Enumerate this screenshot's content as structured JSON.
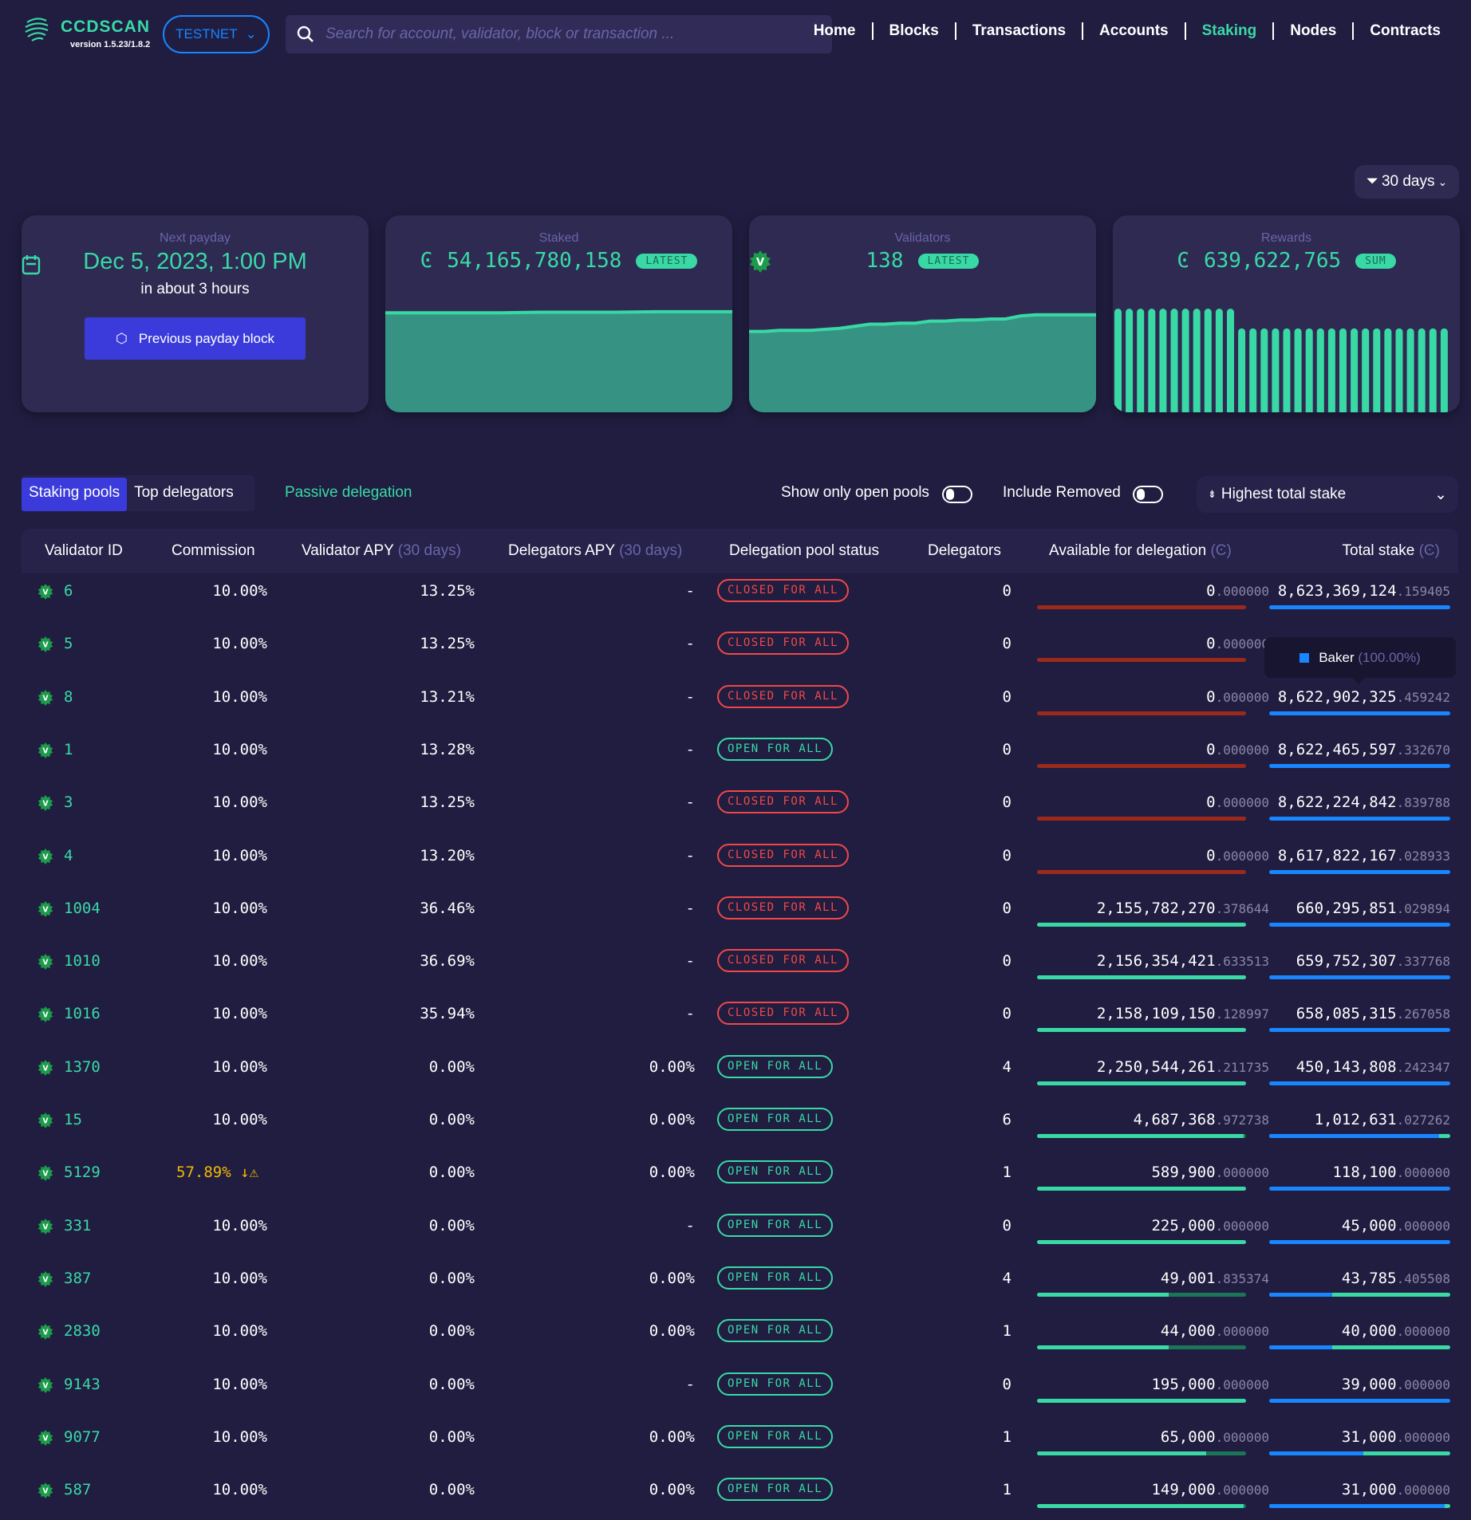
{
  "header": {
    "brand": "CCDSCAN",
    "version": "version 1.5.23/1.8.2",
    "network": "TESTNET",
    "search_placeholder": "Search for account, validator, block or transaction ...",
    "nav": [
      {
        "label": "Home",
        "active": false
      },
      {
        "label": "Blocks",
        "active": false
      },
      {
        "label": "Transactions",
        "active": false
      },
      {
        "label": "Accounts",
        "active": false
      },
      {
        "label": "Staking",
        "active": true
      },
      {
        "label": "Nodes",
        "active": false
      },
      {
        "label": "Contracts",
        "active": false
      }
    ]
  },
  "range_filter": "30 days",
  "cards": {
    "payday": {
      "label": "Next payday",
      "date": "Dec 5, 2023, 1:00 PM",
      "relative": "in about 3 hours",
      "button": "Previous payday block"
    },
    "staked": {
      "label": "Staked",
      "value": "54,165,780,158",
      "badge": "LATEST",
      "currency": "Ͼ"
    },
    "validators": {
      "label": "Validators",
      "value": "138",
      "badge": "LATEST"
    },
    "rewards": {
      "label": "Rewards",
      "value": "639,622,765",
      "badge": "SUM",
      "currency": "Ͼ"
    }
  },
  "chart_data": [
    {
      "type": "area",
      "series": [
        {
          "values": [
            0.96,
            0.96,
            0.96,
            0.96,
            0.965,
            0.965,
            0.965,
            0.97,
            0.97,
            0.97
          ]
        }
      ]
    },
    {
      "type": "area",
      "series": [
        {
          "values": [
            0.78,
            0.78,
            0.79,
            0.79,
            0.79,
            0.8,
            0.81,
            0.83,
            0.85,
            0.85,
            0.86,
            0.86,
            0.88,
            0.88,
            0.89,
            0.89,
            0.9,
            0.9,
            0.93,
            0.94,
            0.94,
            0.94,
            0.94,
            0.94
          ]
        }
      ]
    },
    {
      "type": "bar",
      "series": [
        {
          "values": [
            1,
            1,
            1,
            1,
            1,
            1,
            1,
            1,
            1,
            1,
            1,
            0.81,
            0.81,
            0.81,
            0.81,
            0.81,
            0.81,
            0.81,
            0.81,
            0.81,
            0.81,
            0.81,
            0.81,
            0.81,
            0.81,
            0.81,
            0.81,
            0.81,
            0.81,
            0.81
          ]
        }
      ]
    }
  ],
  "tabs": [
    {
      "label": "Staking pools",
      "active": true
    },
    {
      "label": "Top delegators",
      "active": false
    }
  ],
  "passive_delegation": "Passive delegation",
  "toggles": {
    "open_pools": "Show only open pools",
    "include_removed": "Include Removed"
  },
  "sort": "Highest total stake",
  "columns": {
    "validator_id": "Validator ID",
    "commission": "Commission",
    "validator_apy": "Validator APY",
    "validator_apy_note": "(30 days)",
    "delegators_apy": "Delegators APY",
    "delegators_apy_note": "(30 days)",
    "pool_status": "Delegation pool status",
    "delegators": "Delegators",
    "available": "Available for delegation",
    "available_note": "(Ͼ)",
    "total_stake": "Total stake",
    "total_stake_note": "(Ͼ)"
  },
  "tooltip": {
    "label": "Baker",
    "pct": "(100.00%)"
  },
  "colors": {
    "accent": "#39d9a6",
    "closed": "#f04848",
    "baker": "#1786ff",
    "warning": "#f5b800"
  },
  "rows": [
    {
      "id": "6",
      "commission": "10.00%",
      "vapy": "13.25%",
      "dapy": "-",
      "status": "CLOSED FOR ALL",
      "open": false,
      "delegators": "0",
      "avail_int": "0",
      "avail_dec": ".000000",
      "avail_fill": 0,
      "stake_int": "8,623,369,124",
      "stake_dec": ".159405",
      "baker_share": 1
    },
    {
      "id": "5",
      "commission": "10.00%",
      "vapy": "13.25%",
      "dapy": "-",
      "status": "CLOSED FOR ALL",
      "open": false,
      "delegators": "0",
      "avail_int": "0",
      "avail_dec": ".000000",
      "avail_fill": 0,
      "stake_int": "",
      "stake_dec": "",
      "baker_share": 1
    },
    {
      "id": "8",
      "commission": "10.00%",
      "vapy": "13.21%",
      "dapy": "-",
      "status": "CLOSED FOR ALL",
      "open": false,
      "delegators": "0",
      "avail_int": "0",
      "avail_dec": ".000000",
      "avail_fill": 0,
      "stake_int": "8,622,902,325",
      "stake_dec": ".459242",
      "baker_share": 1
    },
    {
      "id": "1",
      "commission": "10.00%",
      "vapy": "13.28%",
      "dapy": "-",
      "status": "OPEN FOR ALL",
      "open": true,
      "delegators": "0",
      "avail_int": "0",
      "avail_dec": ".000000",
      "avail_fill": 0,
      "stake_int": "8,622,465,597",
      "stake_dec": ".332670",
      "baker_share": 1
    },
    {
      "id": "3",
      "commission": "10.00%",
      "vapy": "13.25%",
      "dapy": "-",
      "status": "CLOSED FOR ALL",
      "open": false,
      "delegators": "0",
      "avail_int": "0",
      "avail_dec": ".000000",
      "avail_fill": 0,
      "stake_int": "8,622,224,842",
      "stake_dec": ".839788",
      "baker_share": 1
    },
    {
      "id": "4",
      "commission": "10.00%",
      "vapy": "13.20%",
      "dapy": "-",
      "status": "CLOSED FOR ALL",
      "open": false,
      "delegators": "0",
      "avail_int": "0",
      "avail_dec": ".000000",
      "avail_fill": 0,
      "stake_int": "8,617,822,167",
      "stake_dec": ".028933",
      "baker_share": 1
    },
    {
      "id": "1004",
      "commission": "10.00%",
      "vapy": "36.46%",
      "dapy": "-",
      "status": "CLOSED FOR ALL",
      "open": false,
      "delegators": "0",
      "avail_int": "2,155,782,270",
      "avail_dec": ".378644",
      "avail_fill": 1,
      "stake_int": "660,295,851",
      "stake_dec": ".029894",
      "baker_share": 1
    },
    {
      "id": "1010",
      "commission": "10.00%",
      "vapy": "36.69%",
      "dapy": "-",
      "status": "CLOSED FOR ALL",
      "open": false,
      "delegators": "0",
      "avail_int": "2,156,354,421",
      "avail_dec": ".633513",
      "avail_fill": 1,
      "stake_int": "659,752,307",
      "stake_dec": ".337768",
      "baker_share": 1
    },
    {
      "id": "1016",
      "commission": "10.00%",
      "vapy": "35.94%",
      "dapy": "-",
      "status": "CLOSED FOR ALL",
      "open": false,
      "delegators": "0",
      "avail_int": "2,158,109,150",
      "avail_dec": ".128997",
      "avail_fill": 1,
      "stake_int": "658,085,315",
      "stake_dec": ".267058",
      "baker_share": 1
    },
    {
      "id": "1370",
      "commission": "10.00%",
      "vapy": "0.00%",
      "dapy": "0.00%",
      "status": "OPEN FOR ALL",
      "open": true,
      "delegators": "4",
      "avail_int": "2,250,544,261",
      "avail_dec": ".211735",
      "avail_fill": 1,
      "stake_int": "450,143,808",
      "stake_dec": ".242347",
      "baker_share": 1
    },
    {
      "id": "15",
      "commission": "10.00%",
      "vapy": "0.00%",
      "dapy": "0.00%",
      "status": "OPEN FOR ALL",
      "open": true,
      "delegators": "6",
      "avail_int": "4,687,368",
      "avail_dec": ".972738",
      "avail_fill": 0.99,
      "stake_int": "1,012,631",
      "stake_dec": ".027262",
      "baker_share": 0.94
    },
    {
      "id": "5129",
      "commission": "57.89%",
      "commission_warning": true,
      "vapy": "0.00%",
      "dapy": "0.00%",
      "status": "OPEN FOR ALL",
      "open": true,
      "delegators": "1",
      "avail_int": "589,900",
      "avail_dec": ".000000",
      "avail_fill": 1,
      "stake_int": "118,100",
      "stake_dec": ".000000",
      "baker_share": 1
    },
    {
      "id": "331",
      "commission": "10.00%",
      "vapy": "0.00%",
      "dapy": "-",
      "status": "OPEN FOR ALL",
      "open": true,
      "delegators": "0",
      "avail_int": "225,000",
      "avail_dec": ".000000",
      "avail_fill": 1,
      "stake_int": "45,000",
      "stake_dec": ".000000",
      "baker_share": 1
    },
    {
      "id": "387",
      "commission": "10.00%",
      "vapy": "0.00%",
      "dapy": "0.00%",
      "status": "OPEN FOR ALL",
      "open": true,
      "delegators": "4",
      "avail_int": "49,001",
      "avail_dec": ".835374",
      "avail_fill": 0.63,
      "stake_int": "43,785",
      "stake_dec": ".405508",
      "baker_share": 0.35
    },
    {
      "id": "2830",
      "commission": "10.00%",
      "vapy": "0.00%",
      "dapy": "0.00%",
      "status": "OPEN FOR ALL",
      "open": true,
      "delegators": "1",
      "avail_int": "44,000",
      "avail_dec": ".000000",
      "avail_fill": 0.63,
      "stake_int": "40,000",
      "stake_dec": ".000000",
      "baker_share": 0.35
    },
    {
      "id": "9143",
      "commission": "10.00%",
      "vapy": "0.00%",
      "dapy": "-",
      "status": "OPEN FOR ALL",
      "open": true,
      "delegators": "0",
      "avail_int": "195,000",
      "avail_dec": ".000000",
      "avail_fill": 1,
      "stake_int": "39,000",
      "stake_dec": ".000000",
      "baker_share": 1
    },
    {
      "id": "9077",
      "commission": "10.00%",
      "vapy": "0.00%",
      "dapy": "0.00%",
      "status": "OPEN FOR ALL",
      "open": true,
      "delegators": "1",
      "avail_int": "65,000",
      "avail_dec": ".000000",
      "avail_fill": 0.81,
      "stake_int": "31,000",
      "stake_dec": ".000000",
      "baker_share": 0.52
    },
    {
      "id": "587",
      "commission": "10.00%",
      "vapy": "0.00%",
      "dapy": "0.00%",
      "status": "OPEN FOR ALL",
      "open": true,
      "delegators": "1",
      "avail_int": "149,000",
      "avail_dec": ".000000",
      "avail_fill": 0.99,
      "stake_int": "31,000",
      "stake_dec": ".000000",
      "baker_share": 0.97
    }
  ]
}
